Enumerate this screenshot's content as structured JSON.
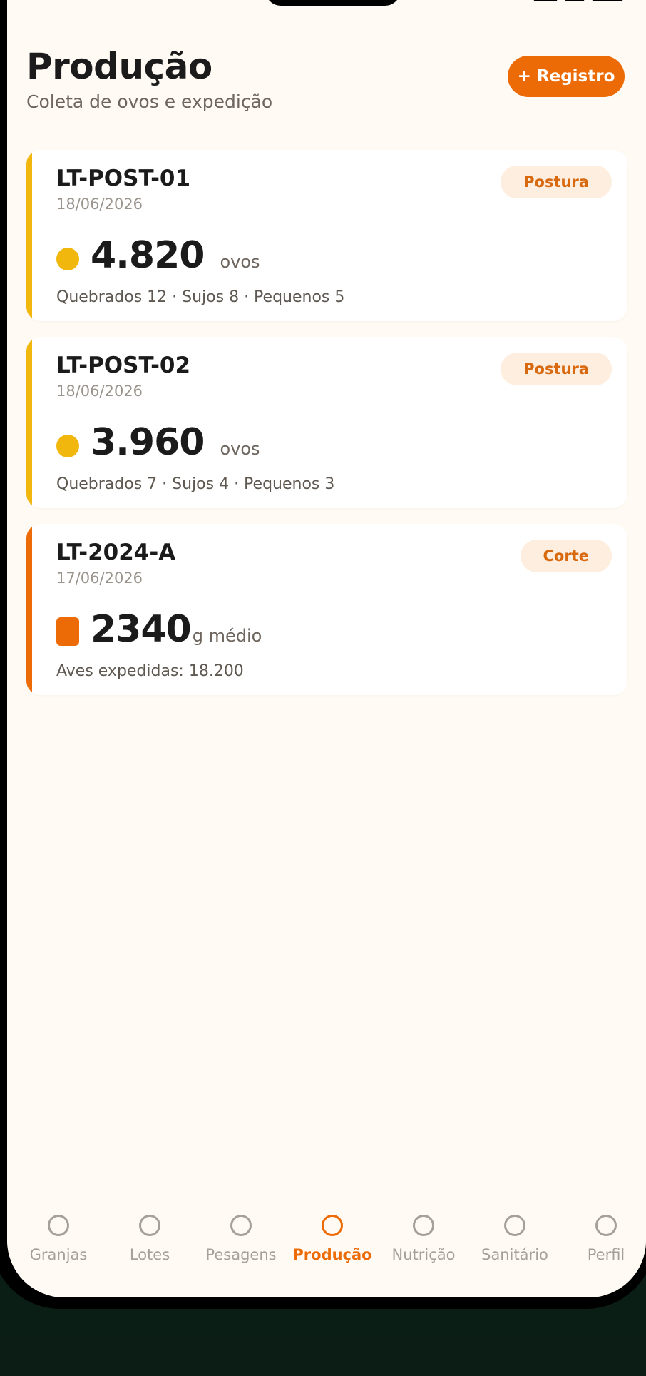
{
  "header": {
    "title": "Produção",
    "subtitle": "Coleta de ovos e expedição",
    "add_label": "+ Registro"
  },
  "cards": [
    {
      "code": "LT-POST-01",
      "date": "18/06/2026",
      "badge": "Postura",
      "value": "4.820",
      "unit": "ovos",
      "detail": "Quebrados 12 · Sujos 8 · Pequenos 5",
      "accent": "#f1b70c",
      "icon": "egg-icon"
    },
    {
      "code": "LT-POST-02",
      "date": "18/06/2026",
      "badge": "Postura",
      "value": "3.960",
      "unit": "ovos",
      "detail": "Quebrados 7 · Sujos 4 · Pequenos 3",
      "accent": "#f1b70c",
      "icon": "egg-icon"
    },
    {
      "code": "LT-2024-A",
      "date": "17/06/2026",
      "badge": "Corte",
      "value": "2340",
      "unit": "g médio",
      "detail": "Aves expedidas: 18.200",
      "accent": "#ec6b07",
      "icon": "weight-icon"
    }
  ],
  "nav": {
    "items": [
      {
        "label": "Granjas",
        "active": false
      },
      {
        "label": "Lotes",
        "active": false
      },
      {
        "label": "Pesagens",
        "active": false
      },
      {
        "label": "Produção",
        "active": true
      },
      {
        "label": "Nutrição",
        "active": false
      },
      {
        "label": "Sanitário",
        "active": false
      },
      {
        "label": "Perfil",
        "active": false
      }
    ]
  },
  "colors": {
    "accent": "#ec6b07",
    "egg": "#f1b70c",
    "background": "#fffaf3"
  }
}
